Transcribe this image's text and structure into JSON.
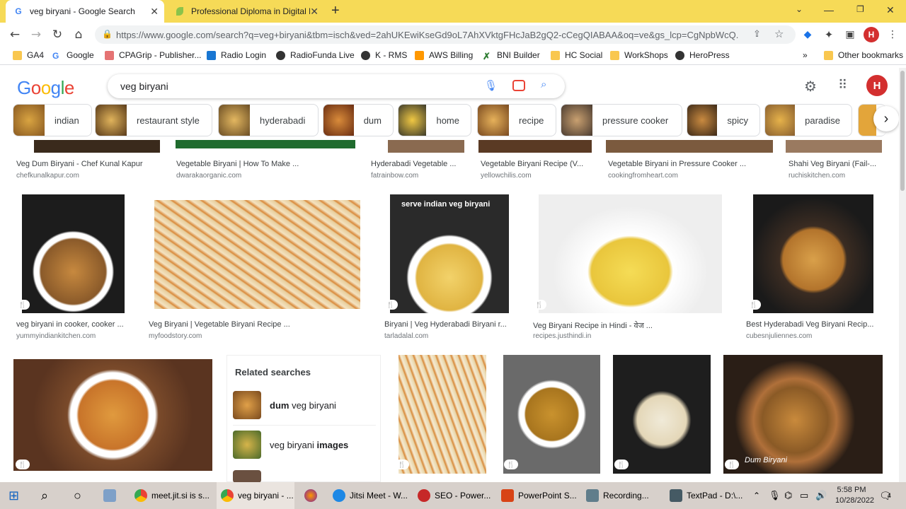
{
  "tabs": [
    {
      "title": "veg biryani - Google Search",
      "favicon": "google-icon",
      "active": true
    },
    {
      "title": "Professional Diploma in Digital M",
      "favicon": "leaf-icon",
      "active": false
    }
  ],
  "toolbar": {
    "url": "https://www.google.com/search?q=veg+biryani&tbm=isch&ved=2ahUKEwiKseGd9oL7AhXVktgFHcJaB2gQ2-cCegQIABAA&oq=ve&gs_lcp=CgNpbWcQ..."
  },
  "bookmarks": [
    "GA4",
    "Google",
    "CPAGrip - Publisher...",
    "Radio Login",
    "RadioFunda Live",
    "K - RMS",
    "AWS Billing",
    "BNI Builder",
    "HC Social",
    "WorkShops",
    "HeroPress"
  ],
  "other_bookmarks": "Other bookmarks",
  "search": {
    "query": "veg biryani"
  },
  "chips": [
    "indian",
    "restaurant style",
    "hyderabadi",
    "dum",
    "home",
    "recipe",
    "pressure cooker",
    "spicy",
    "paradise"
  ],
  "row1": [
    {
      "caption": "Veg Dum Biryani - Chef Kunal Kapur",
      "source": "chefkunalkapur.com"
    },
    {
      "caption": "Vegetable Biryani | How To Make ...",
      "source": "dwarakaorganic.com"
    },
    {
      "caption": "Hyderabadi Vegetable ...",
      "source": "fatrainbow.com"
    },
    {
      "caption": "Vegetable Biryani Recipe (V...",
      "source": "yellowchilis.com"
    },
    {
      "caption": "Vegetable Biryani in Pressure Cooker ...",
      "source": "cookingfromheart.com"
    },
    {
      "caption": "Shahi Veg Biryani (Fail-...",
      "source": "ruchiskitchen.com"
    }
  ],
  "row2": [
    {
      "caption": "veg biryani in cooker, cooker ...",
      "source": "yummyindiankitchen.com"
    },
    {
      "caption": "Veg Biryani | Vegetable Biryani Recipe ...",
      "source": "myfoodstory.com"
    },
    {
      "caption": "Biryani | Veg Hyderabadi Biryani r...",
      "source": "tarladalal.com",
      "overlay": "serve indian veg biryani"
    },
    {
      "caption": "Veg Biryani Recipe in Hindi - वेज ...",
      "source": "recipes.justhindi.in"
    },
    {
      "caption": "Best Hyderabadi Veg Biryani Recip...",
      "source": "cubesnjuliennes.com"
    }
  ],
  "related": {
    "title": "Related searches",
    "items": [
      {
        "bold": "dum",
        "rest": " veg biryani"
      },
      {
        "pre": "veg biryani ",
        "bold": "images"
      }
    ]
  },
  "row3_overlay": "Dum Biryani",
  "taskbar": {
    "items": [
      "meet.jit.si is s...",
      "veg biryani - ...",
      "Jitsi Meet - W...",
      "SEO - Power...",
      "PowerPoint S...",
      "Recording...",
      "TextPad - D:\\..."
    ],
    "time": "5:58 PM",
    "date": "10/28/2022",
    "notifications": "4"
  },
  "colors": {
    "tabstrip": "#f6da57",
    "taskbar": "#d7d0cb",
    "link": "#1a0dab"
  }
}
